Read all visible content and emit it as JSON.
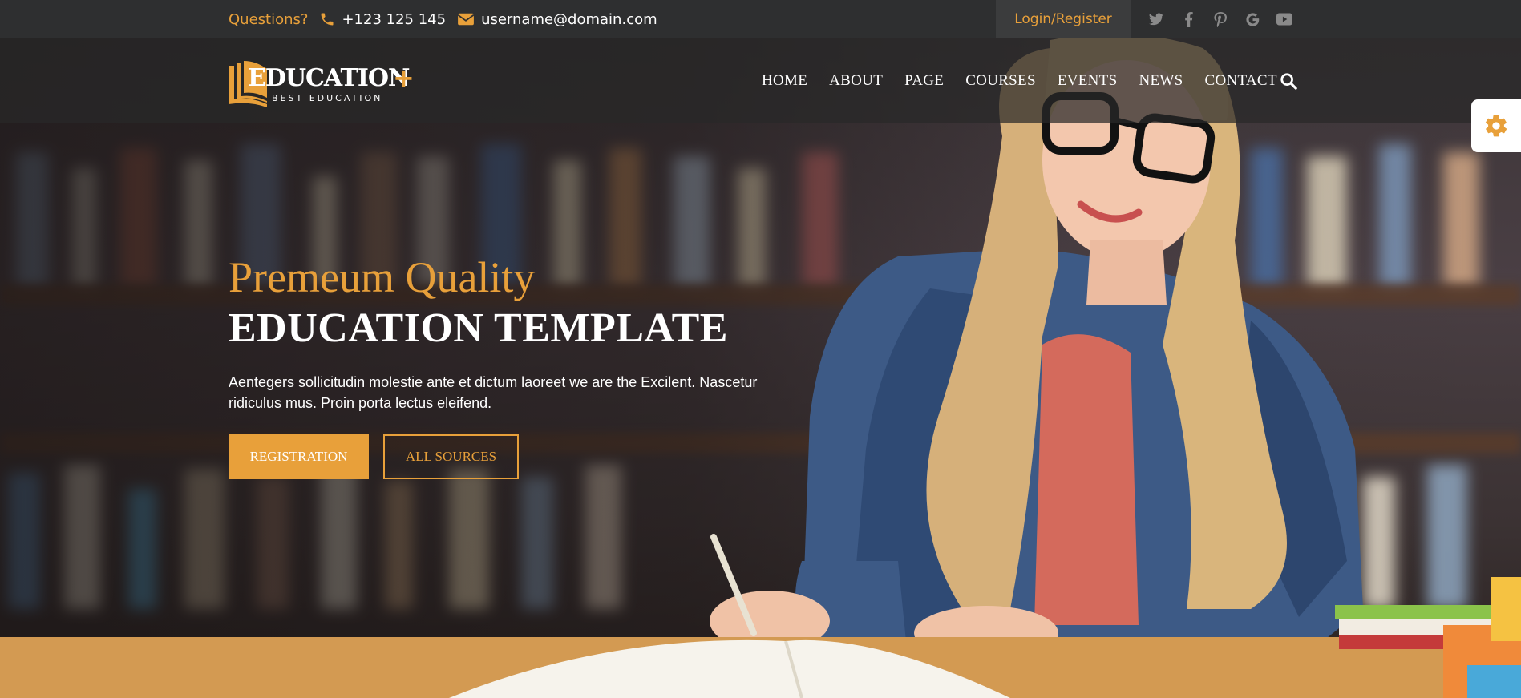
{
  "topbar": {
    "questions_label": "Questions?",
    "phone": "+123 125 145",
    "email": "username@domain.com",
    "login_label": "Login/Register",
    "socials": [
      "twitter-icon",
      "facebook-icon",
      "pinterest-icon",
      "google-icon",
      "youtube-icon"
    ]
  },
  "logo": {
    "name": "EDUCATION",
    "plus": "+",
    "tagline": "BEST EDUCATION"
  },
  "nav": {
    "items": [
      "HOME",
      "ABOUT",
      "PAGE",
      "COURSES",
      "EVENTS",
      "NEWS",
      "CONTACT"
    ]
  },
  "hero": {
    "subtitle": "Premeum Quality",
    "title": "EDUCATION TEMPLATE",
    "description": "Aentegers sollicitudin molestie ante et dictum laoreet we are the Excilent. Nascetur ridiculus mus. Proin porta lectus eleifend.",
    "primary_button": "REGISTRATION",
    "secondary_button": "ALL SOURCES"
  },
  "colors": {
    "accent": "#e8a03a",
    "topbar_bg": "#2e2f30"
  }
}
